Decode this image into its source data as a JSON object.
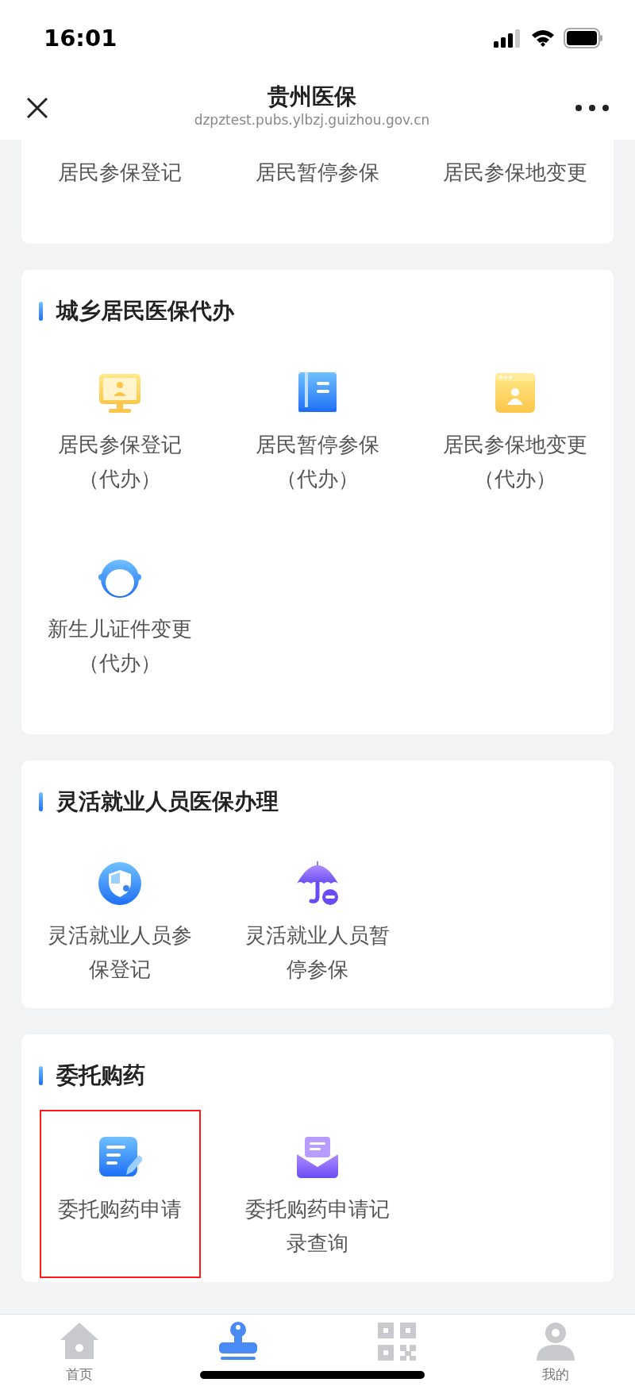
{
  "status_bar": {
    "time": "16:01"
  },
  "header": {
    "title": "贵州医保",
    "url": "dzpztest.pubs.ylbzj.guizhou.gov.cn"
  },
  "sections": [
    {
      "items": [
        {
          "kind": "text",
          "label": "居民参保登记",
          "highlighted": false
        },
        {
          "kind": "text",
          "label": "居民暂停参保",
          "highlighted": false
        },
        {
          "kind": "text",
          "label": "居民参保地变更",
          "highlighted": false
        }
      ]
    },
    {
      "title": "城乡居民医保代办",
      "items": [
        {
          "kind": "monitor",
          "label": "居民参保登记",
          "note": "（代办）",
          "highlighted": false
        },
        {
          "kind": "book",
          "label": "居民暂停参保",
          "note": "（代办）",
          "highlighted": false
        },
        {
          "kind": "window",
          "label": "居民参保地变更",
          "note": "（代办）",
          "highlighted": false
        },
        {
          "kind": "child",
          "label": "新生儿证件变更",
          "note": "（代办）",
          "highlighted": false
        }
      ]
    },
    {
      "title": "灵活就业人员医保办理",
      "items": [
        {
          "kind": "shield",
          "label": "灵活就业人员参保登记",
          "highlighted": false
        },
        {
          "kind": "umbrella",
          "label": "灵活就业人员暂停参保",
          "highlighted": false
        }
      ]
    },
    {
      "title": "委托购药",
      "items": [
        {
          "kind": "note",
          "label": "委托购药申请",
          "highlighted": true
        },
        {
          "kind": "envelope",
          "label": "委托购药申请记录查询",
          "highlighted": false
        }
      ]
    }
  ],
  "tabs": [
    {
      "kind": "home",
      "label": "首页",
      "selected": false
    },
    {
      "kind": "stamp",
      "selected": true
    },
    {
      "kind": "qr",
      "selected": false
    },
    {
      "kind": "person",
      "label": "我的",
      "selected": false
    }
  ]
}
